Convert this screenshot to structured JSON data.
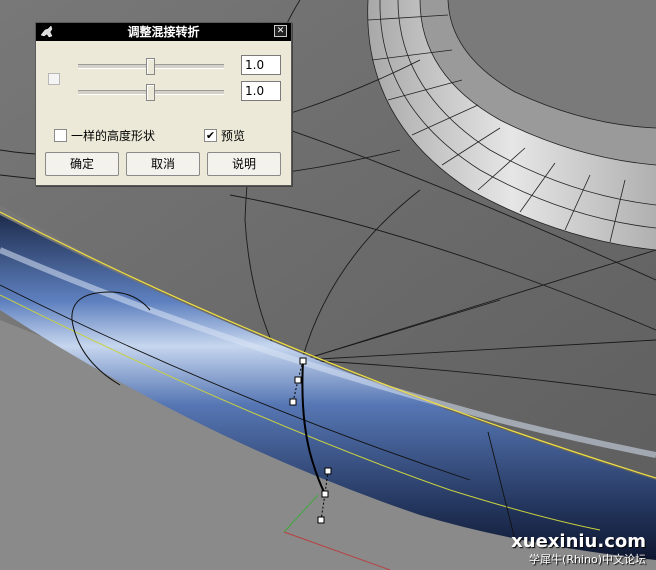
{
  "dialog": {
    "title": "调整混接转折",
    "close_glyph": "✕",
    "slider_1": {
      "value_text": "1.0",
      "position": 0.5
    },
    "slider_2": {
      "value_text": "1.0",
      "position": 0.5
    },
    "same_height_label": "一样的高度形状",
    "same_height_checked": false,
    "preview_label": "预览",
    "preview_checked": true,
    "check_glyph": "✔",
    "buttons": {
      "ok": "确定",
      "cancel": "取消",
      "help": "说明"
    }
  },
  "watermark": {
    "site": "xuexiniu.com",
    "subtitle": "学犀牛(Rhino)中文论坛"
  },
  "colors": {
    "viewport_background": "#6e6e6e",
    "tube_blue": "#3c5a9a",
    "edge_yellow": "#f0e040",
    "control_point": "#ffffff"
  }
}
